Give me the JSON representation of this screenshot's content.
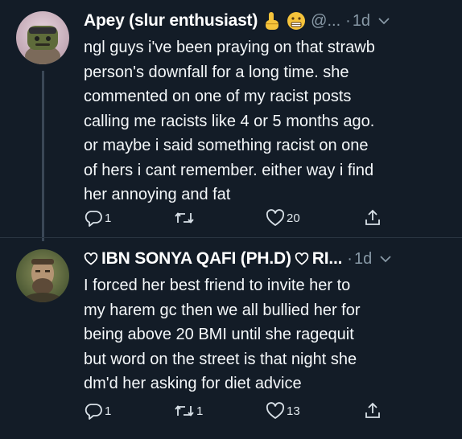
{
  "tweets": [
    {
      "author_name": "Apey (slur enthusiast)",
      "handle": "@...",
      "separator": "·",
      "time": "1d",
      "text": "ngl guys i've been praying on that strawb\nperson's downfall for a long time. she\ncommented on one of my racist posts\ncalling me racists like 4 or 5 months ago.\nor maybe i said something racist on one\nof hers i cant remember. either way i find\nher annoying and fat",
      "reply_count": "1",
      "retweet_count": "",
      "like_count": "20"
    },
    {
      "author_name": "IBN SONYA QAFI (PH.D)",
      "author_name_suffix": "RI...",
      "separator": "·",
      "time": "1d",
      "text": "I forced her best friend to invite her to\nmy harem gc then we all bullied her for\nbeing above 20 BMI until she ragequit\nbut word on the street is that night she\ndm'd her asking for diet advice",
      "reply_count": "1",
      "retweet_count": "1",
      "like_count": "13"
    }
  ],
  "colors": {
    "background": "#131c27",
    "muted": "#8899a6",
    "text": "#f5f8fa"
  },
  "icons": [
    "pointing-hand-emoji-icon",
    "grimace-emoji-icon",
    "chevron-down-icon",
    "reply-icon",
    "retweet-icon",
    "like-icon",
    "share-icon",
    "heart-outline-icon"
  ]
}
